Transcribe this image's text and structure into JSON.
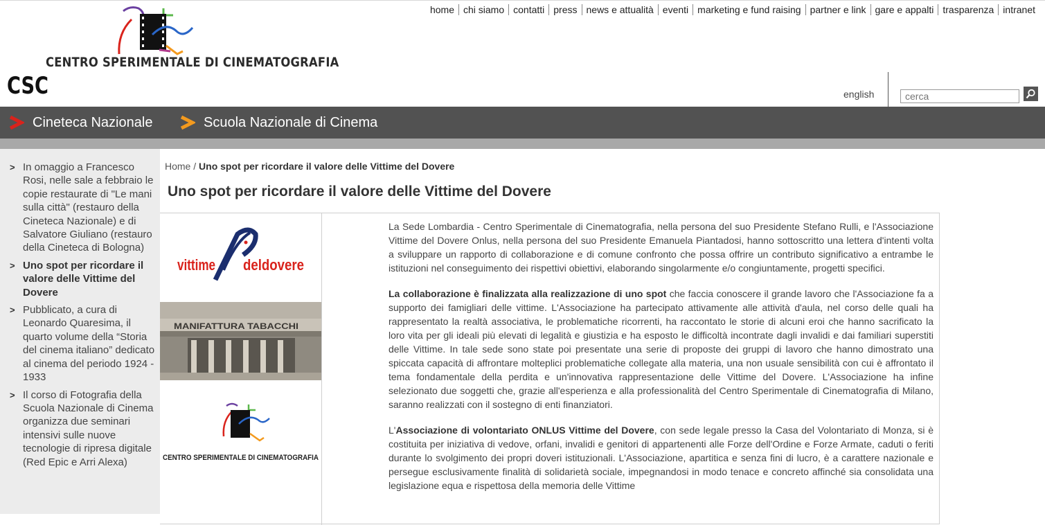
{
  "header": {
    "logo_name": "CENTRO SPERIMENTALE DI CINEMATOGRAFIA",
    "logo_short": "CSC"
  },
  "topnav": [
    "home",
    "chi siamo",
    "contatti",
    "press",
    "news e attualità",
    "eventi",
    "marketing e fund raising",
    "partner e link",
    "gare e appalti",
    "trasparenza",
    "intranet"
  ],
  "language": "english",
  "search": {
    "placeholder": "cerca"
  },
  "mainnav": {
    "items": [
      "Cineteca Nazionale",
      "Scuola Nazionale di Cinema"
    ],
    "chevron_colors": [
      "#d9231c",
      "#f39a1e"
    ]
  },
  "sidebar": {
    "items": [
      "In omaggio a Francesco Rosi, nelle sale a febbraio le copie restaurate di \"Le mani sulla città\" (restauro della Cineteca Nazionale) e di Salvatore Giuliano (restauro della Cineteca di Bologna)",
      "Uno spot per ricordare il valore delle Vittime del Dovere",
      "Pubblicato, a cura di Leonardo Quaresima, il quarto volume della “Storia del cinema italiano” dedicato al cinema del periodo 1924 - 1933",
      "Il corso di Fotografia della Scuola Nazionale di Cinema organizza due seminari intensivi sulle nuove tecnologie di ripresa digitale (Red Epic e Arri Alexa)"
    ]
  },
  "breadcrumb": {
    "home": "Home",
    "sep": " / ",
    "current": "Uno spot per ricordare il valore delle Vittime del Dovere"
  },
  "article": {
    "title": "Uno spot per ricordare il valore delle Vittime del Dovere",
    "images": {
      "vittime_logo_a": "vittime",
      "vittime_logo_b": "deldovere",
      "building_sign": "MANIFATTURA TABACCHI",
      "csc_caption": "CENTRO SPERIMENTALE DI CINEMATOGRAFIA"
    },
    "p1": "La Sede Lombardia - Centro Sperimentale di Cinematografia, nella persona del suo Presidente Stefano Rulli, e l'Associazione Vittime del Dovere Onlus, nella persona del suo Presidente Emanuela Piantadosi, hanno sottoscritto una lettera d'intenti volta a sviluppare un rapporto di collaborazione e di comune confronto che possa offrire un contributo significativo a entrambe le istituzioni nel conseguimento dei rispettivi obiettivi, elaborando singolarmente e/o congiuntamente, progetti specifici.",
    "p2_bold": "La collaborazione è finalizzata alla realizzazione di uno spot",
    "p2_rest": " che faccia conoscere il grande lavoro che l'Associazione fa a supporto dei famigliari delle vittime. L'Associazione ha partecipato attivamente alle attività d'aula, nel corso delle quali ha rappresentato la realtà associativa, le problematiche ricorrenti, ha raccontato le storie di alcuni eroi che hanno sacrificato la loro vita per gli ideali più elevati di legalità e giustizia e ha esposto le difficoltà incontrate dagli invalidi e dai familiari superstiti delle Vittime. In tale sede sono state poi presentate una serie di proposte dei gruppi di lavoro che hanno dimostrato una spiccata capacità di affrontare molteplici problematiche collegate alla materia, una non usuale sensibilità con cui è affrontato il tema fondamentale della perdita e un'innovativa rappresentazione delle Vittime del Dovere. L'Associazione ha infine selezionato due soggetti che, grazie all'esperienza e alla professionalità del Centro Sperimentale di Cinematografia di Milano, saranno realizzati con il sostegno di enti finanziatori.",
    "p3_pre": "L'",
    "p3_bold": "Associazione di volontariato ONLUS Vittime del Dovere",
    "p3_rest": ", con sede legale presso la Casa del Volontariato di Monza, si è costituita per iniziativa di vedove, orfani, invalidi e genitori di appartenenti alle Forze dell'Ordine e Forze Armate, caduti o feriti durante lo svolgimento dei propri doveri istituzionali. L'Associazione, apartitica e senza fini di lucro, è a carattere nazionale e persegue esclusivamente finalità di solidarietà sociale, impegnandosi in modo tenace e concreto affinché sia consolidata una legislazione equa e rispettosa della memoria delle Vittime"
  }
}
